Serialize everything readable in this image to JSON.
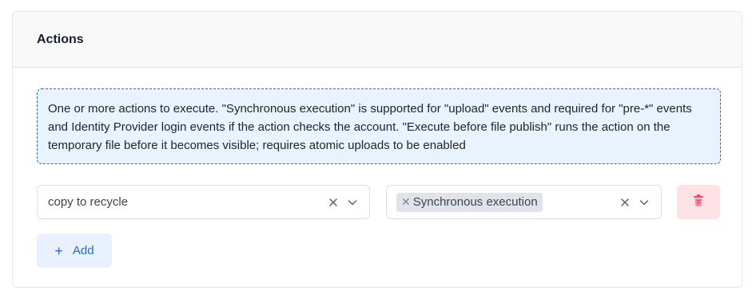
{
  "card": {
    "title": "Actions"
  },
  "notice": {
    "text": "One or more actions to execute. \"Synchronous execution\" is supported for \"upload\" events and required for \"pre-*\" events and Identity Provider login events if the action checks the account. \"Execute before file publish\" runs the action on the temporary file before it becomes visible; requires atomic uploads to be enabled"
  },
  "action_row": {
    "action_select": {
      "value": "copy to recycle",
      "clear_icon": "close-icon",
      "dropdown_icon": "chevron-down-icon"
    },
    "options_select": {
      "tags": [
        "Synchronous execution"
      ],
      "clear_icon": "close-icon",
      "dropdown_icon": "chevron-down-icon"
    },
    "delete_icon": "trash-icon"
  },
  "add_button": {
    "label": "Add",
    "icon": "plus-icon"
  },
  "colors": {
    "accent": "#1b6ed6",
    "notice_bg": "#e9f3ff",
    "notice_border": "#1f6fb4",
    "danger": "#f1416c",
    "danger_bg": "#ffe2e6"
  }
}
